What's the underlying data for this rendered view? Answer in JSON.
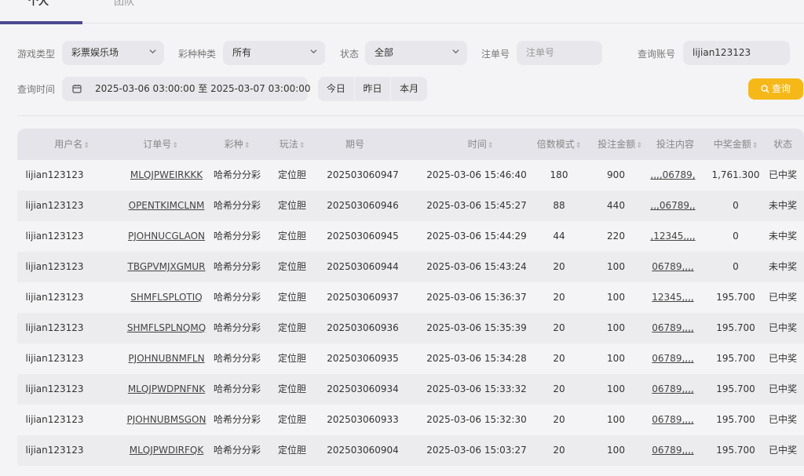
{
  "tabs": [
    {
      "label": "个人"
    },
    {
      "label": "团队"
    }
  ],
  "filters": {
    "game_type_label": "游戏类型",
    "game_type_value": "彩票娱乐场",
    "lottery_label": "彩种种类",
    "lottery_value": "所有",
    "status_label": "状态",
    "status_value": "全部",
    "order_label": "注单号",
    "order_placeholder": "注单号",
    "account_label": "查询账号",
    "account_value": "lijian123123",
    "time_label": "查询时间",
    "time_value": "2025-03-06 03:00:00 至 2025-03-07 03:00:00",
    "quick": [
      "今日",
      "昨日",
      "本月"
    ],
    "search_label": "查询"
  },
  "table": {
    "headers": [
      "用户名",
      "订单号",
      "彩种",
      "玩法",
      "期号",
      "时间",
      "倍数模式",
      "投注金额",
      "投注内容",
      "中奖金额",
      "状态"
    ],
    "rows": [
      [
        "lijian123123",
        "MLQJPWEIRKKK",
        "哈希分分彩",
        "定位胆",
        "202503060947",
        "2025-03-06 15:46:40",
        "180",
        "900",
        ",,,,06789,",
        "1,761.300",
        "已中奖"
      ],
      [
        "lijian123123",
        "OPENTKIMCLNM",
        "哈希分分彩",
        "定位胆",
        "202503060946",
        "2025-03-06 15:45:27",
        "88",
        "440",
        ",,,06789,,",
        "0",
        "未中奖"
      ],
      [
        "lijian123123",
        "PJOHNUCGLAON",
        "哈希分分彩",
        "定位胆",
        "202503060945",
        "2025-03-06 15:44:29",
        "44",
        "220",
        ",12345,,,,",
        "0",
        "未中奖"
      ],
      [
        "lijian123123",
        "TBGPVMJXGMUR",
        "哈希分分彩",
        "定位胆",
        "202503060944",
        "2025-03-06 15:43:24",
        "20",
        "100",
        "06789,,,,",
        "0",
        "未中奖"
      ],
      [
        "lijian123123",
        "SHMFLSPLOTIQ",
        "哈希分分彩",
        "定位胆",
        "202503060937",
        "2025-03-06 15:36:37",
        "20",
        "100",
        "12345,,,,",
        "195.700",
        "已中奖"
      ],
      [
        "lijian123123",
        "SHMFLSPLNQMQ",
        "哈希分分彩",
        "定位胆",
        "202503060936",
        "2025-03-06 15:35:39",
        "20",
        "100",
        "06789,,,,",
        "195.700",
        "已中奖"
      ],
      [
        "lijian123123",
        "PJOHNUBNMFLN",
        "哈希分分彩",
        "定位胆",
        "202503060935",
        "2025-03-06 15:34:28",
        "20",
        "100",
        "06789,,,,",
        "195.700",
        "已中奖"
      ],
      [
        "lijian123123",
        "MLQJPWDPNFNK",
        "哈希分分彩",
        "定位胆",
        "202503060934",
        "2025-03-06 15:33:32",
        "20",
        "100",
        "06789,,,,",
        "195.700",
        "已中奖"
      ],
      [
        "lijian123123",
        "PJOHNUBMSGON",
        "哈希分分彩",
        "定位胆",
        "202503060933",
        "2025-03-06 15:32:30",
        "20",
        "100",
        "06789,,,,",
        "195.700",
        "已中奖"
      ],
      [
        "lijian123123",
        "MLQJPWDIRFQK",
        "哈希分分彩",
        "定位胆",
        "202503060904",
        "2025-03-06 15:03:27",
        "20",
        "100",
        "06789,,,,",
        "195.700",
        "已中奖"
      ]
    ]
  },
  "colors": {
    "accent": "#4b4a8f",
    "search_button": "#f6b819"
  },
  "icons": {
    "dropdown": "chevron-down-icon",
    "calendar": "calendar-icon",
    "search": "search-icon"
  }
}
